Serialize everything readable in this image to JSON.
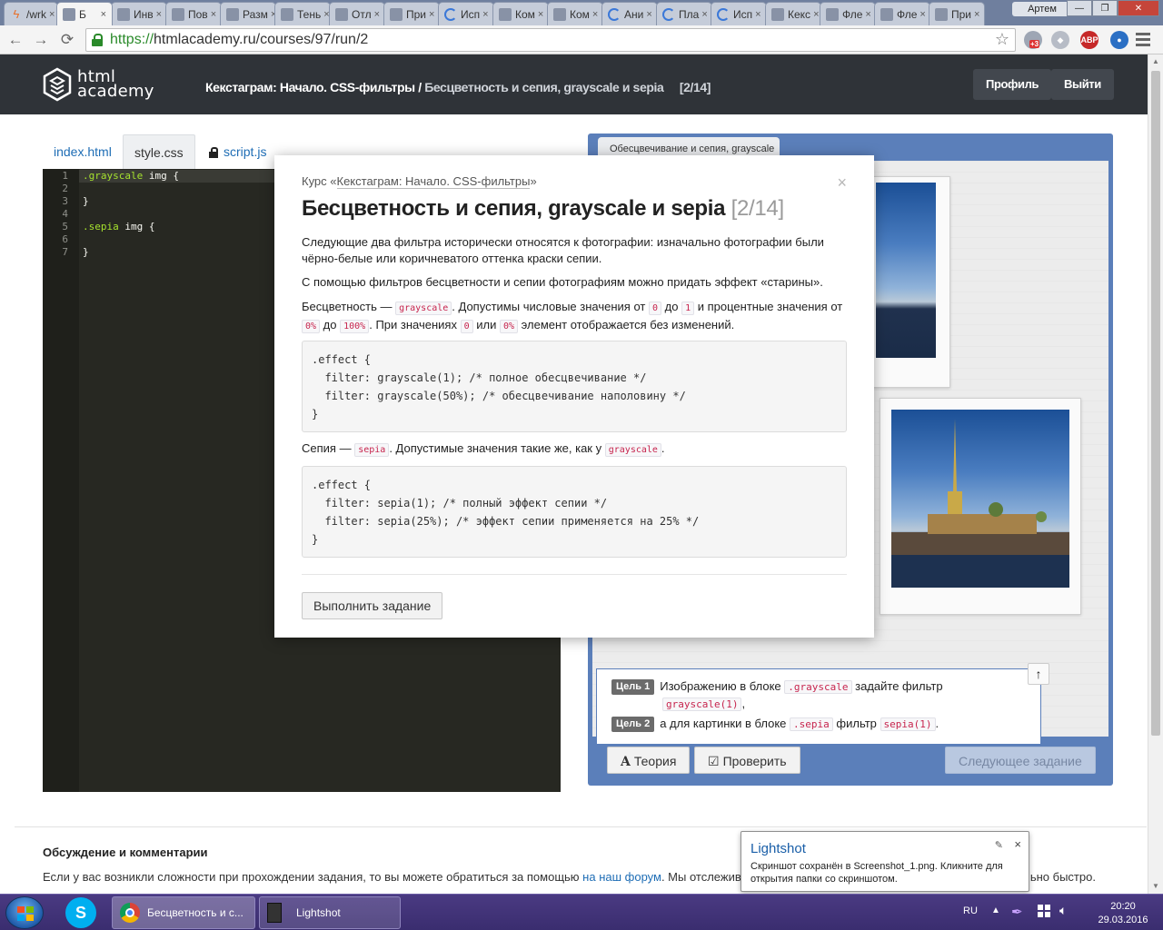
{
  "browser": {
    "tabs": [
      {
        "label": "/wrk",
        "icon": "bolt-icon"
      },
      {
        "label": "Б",
        "icon": "academy-icon",
        "active": true
      },
      {
        "label": "Инв",
        "icon": "academy-icon"
      },
      {
        "label": "Пов",
        "icon": "academy-icon"
      },
      {
        "label": "Разм",
        "icon": "academy-icon"
      },
      {
        "label": "Тень",
        "icon": "academy-icon"
      },
      {
        "label": "Отл",
        "icon": "academy-icon"
      },
      {
        "label": "При",
        "icon": "academy-icon"
      },
      {
        "label": "Исп",
        "icon": "loading-icon"
      },
      {
        "label": "Ком",
        "icon": "academy-icon"
      },
      {
        "label": "Ком",
        "icon": "academy-icon"
      },
      {
        "label": "Ани",
        "icon": "loading-icon"
      },
      {
        "label": "Пла",
        "icon": "loading-icon"
      },
      {
        "label": "Исп",
        "icon": "loading-icon"
      },
      {
        "label": "Кекс",
        "icon": "academy-icon"
      },
      {
        "label": "Фле",
        "icon": "academy-icon"
      },
      {
        "label": "Фле",
        "icon": "academy-icon"
      },
      {
        "label": "При",
        "icon": "academy-icon"
      }
    ],
    "user": "Артем",
    "url_scheme": "https://",
    "url_rest": "htmlacademy.ru/courses/97/run/2",
    "ext_badge": "+3",
    "abp": "ABP"
  },
  "header": {
    "logo_line1": "html",
    "logo_line2": "academy",
    "course": "Кекстаграм: Начало. CSS-фильтры /",
    "lesson": "Бесцветность и сепия, grayscale и sepia",
    "counter": "[2/14]",
    "profile": "Профиль",
    "logout": "Выйти"
  },
  "editor": {
    "tabs": [
      "index.html",
      "style.css",
      "script.js"
    ],
    "lines": [
      {
        "n": "1",
        "sel": ".grayscale",
        "rest": " img {"
      },
      {
        "n": "2",
        "sel": "",
        "rest": ""
      },
      {
        "n": "3",
        "sel": "",
        "rest": "}"
      },
      {
        "n": "4",
        "sel": "",
        "rest": ""
      },
      {
        "n": "5",
        "sel": ".sepia",
        "rest": " img {"
      },
      {
        "n": "6",
        "sel": "",
        "rest": ""
      },
      {
        "n": "7",
        "sel": "",
        "rest": "}"
      }
    ]
  },
  "preview": {
    "tab_label": "Обесцвечивание и сепия, grayscale",
    "goal1_label": "Цель 1",
    "goal1_a": "Изображению в блоке",
    "goal1_code1": ".grayscale",
    "goal1_b": "задайте фильтр",
    "goal1_code2": "grayscale(1)",
    "goal1_c": ",",
    "goal2_label": "Цель 2",
    "goal2_a": "а для картинки в блоке",
    "goal2_code1": ".sepia",
    "goal2_b": "фильтр",
    "goal2_code2": "sepia(1)",
    "goal2_c": ".",
    "up": "↑",
    "theory": "Теория",
    "check": "Проверить",
    "next": "Следующее задание"
  },
  "modal": {
    "course_prefix": "Курс «",
    "course_link": "Кекстаграм: Начало. CSS-фильтры",
    "course_suffix": "»",
    "close": "×",
    "title": "Бесцветность и сепия, grayscale и sepia",
    "title_count": "[2/14]",
    "p1": "Следующие два фильтра исторически относятся к фотографии: изначально фотографии были чёрно-белые или коричневатого оттенка краски сепии.",
    "p2": "С помощью фильтров бесцветности и сепии фотографиям можно придать эффект «старины».",
    "p3": {
      "t1": "Бесцветность —",
      "c1": "grayscale",
      "t2": ". Допустимы числовые значения от",
      "c2": "0",
      "t3": "до",
      "c3": "1",
      "t4": "и процентные значения от",
      "c4": "0%",
      "t5": "до",
      "c5": "100%",
      "t6": ". При значениях",
      "c6": "0",
      "t7": "или",
      "c7": "0%",
      "t8": "элемент отображается без изменений."
    },
    "code1": ".effect {\n  filter: grayscale(1); /* полное обесцвечивание */\n  filter: grayscale(50%); /* обесцвечивание наполовину */\n}",
    "p4": {
      "t1": "Сепия —",
      "c1": "sepia",
      "t2": ". Допустимые значения такие же, как у",
      "c2": "grayscale",
      "t3": "."
    },
    "code2": ".effect {\n  filter: sepia(1); /* полный эффект сепии */\n  filter: sepia(25%); /* эффект сепии применяется на 25% */\n}",
    "action": "Выполнить задание"
  },
  "discussion": {
    "title": "Обсуждение и комментарии",
    "text_a": "Если у вас возникли сложности при прохождении задания, то вы можете обратиться за помощью",
    "link": "на наш форум",
    "text_b": ". Мы отслеживаем вопросы и стараемся ответить на них максимально быстро."
  },
  "lightshot": {
    "title": "Lightshot",
    "text": "Скриншот сохранён в Screenshot_1.png. Кликните для открытия папки со скриншотом.",
    "close": "×"
  },
  "taskbar": {
    "chrome_label": "Бесцветность и с...",
    "lightshot_label": "Lightshot",
    "lang": "RU",
    "time": "20:20",
    "date": "29.03.2016"
  }
}
